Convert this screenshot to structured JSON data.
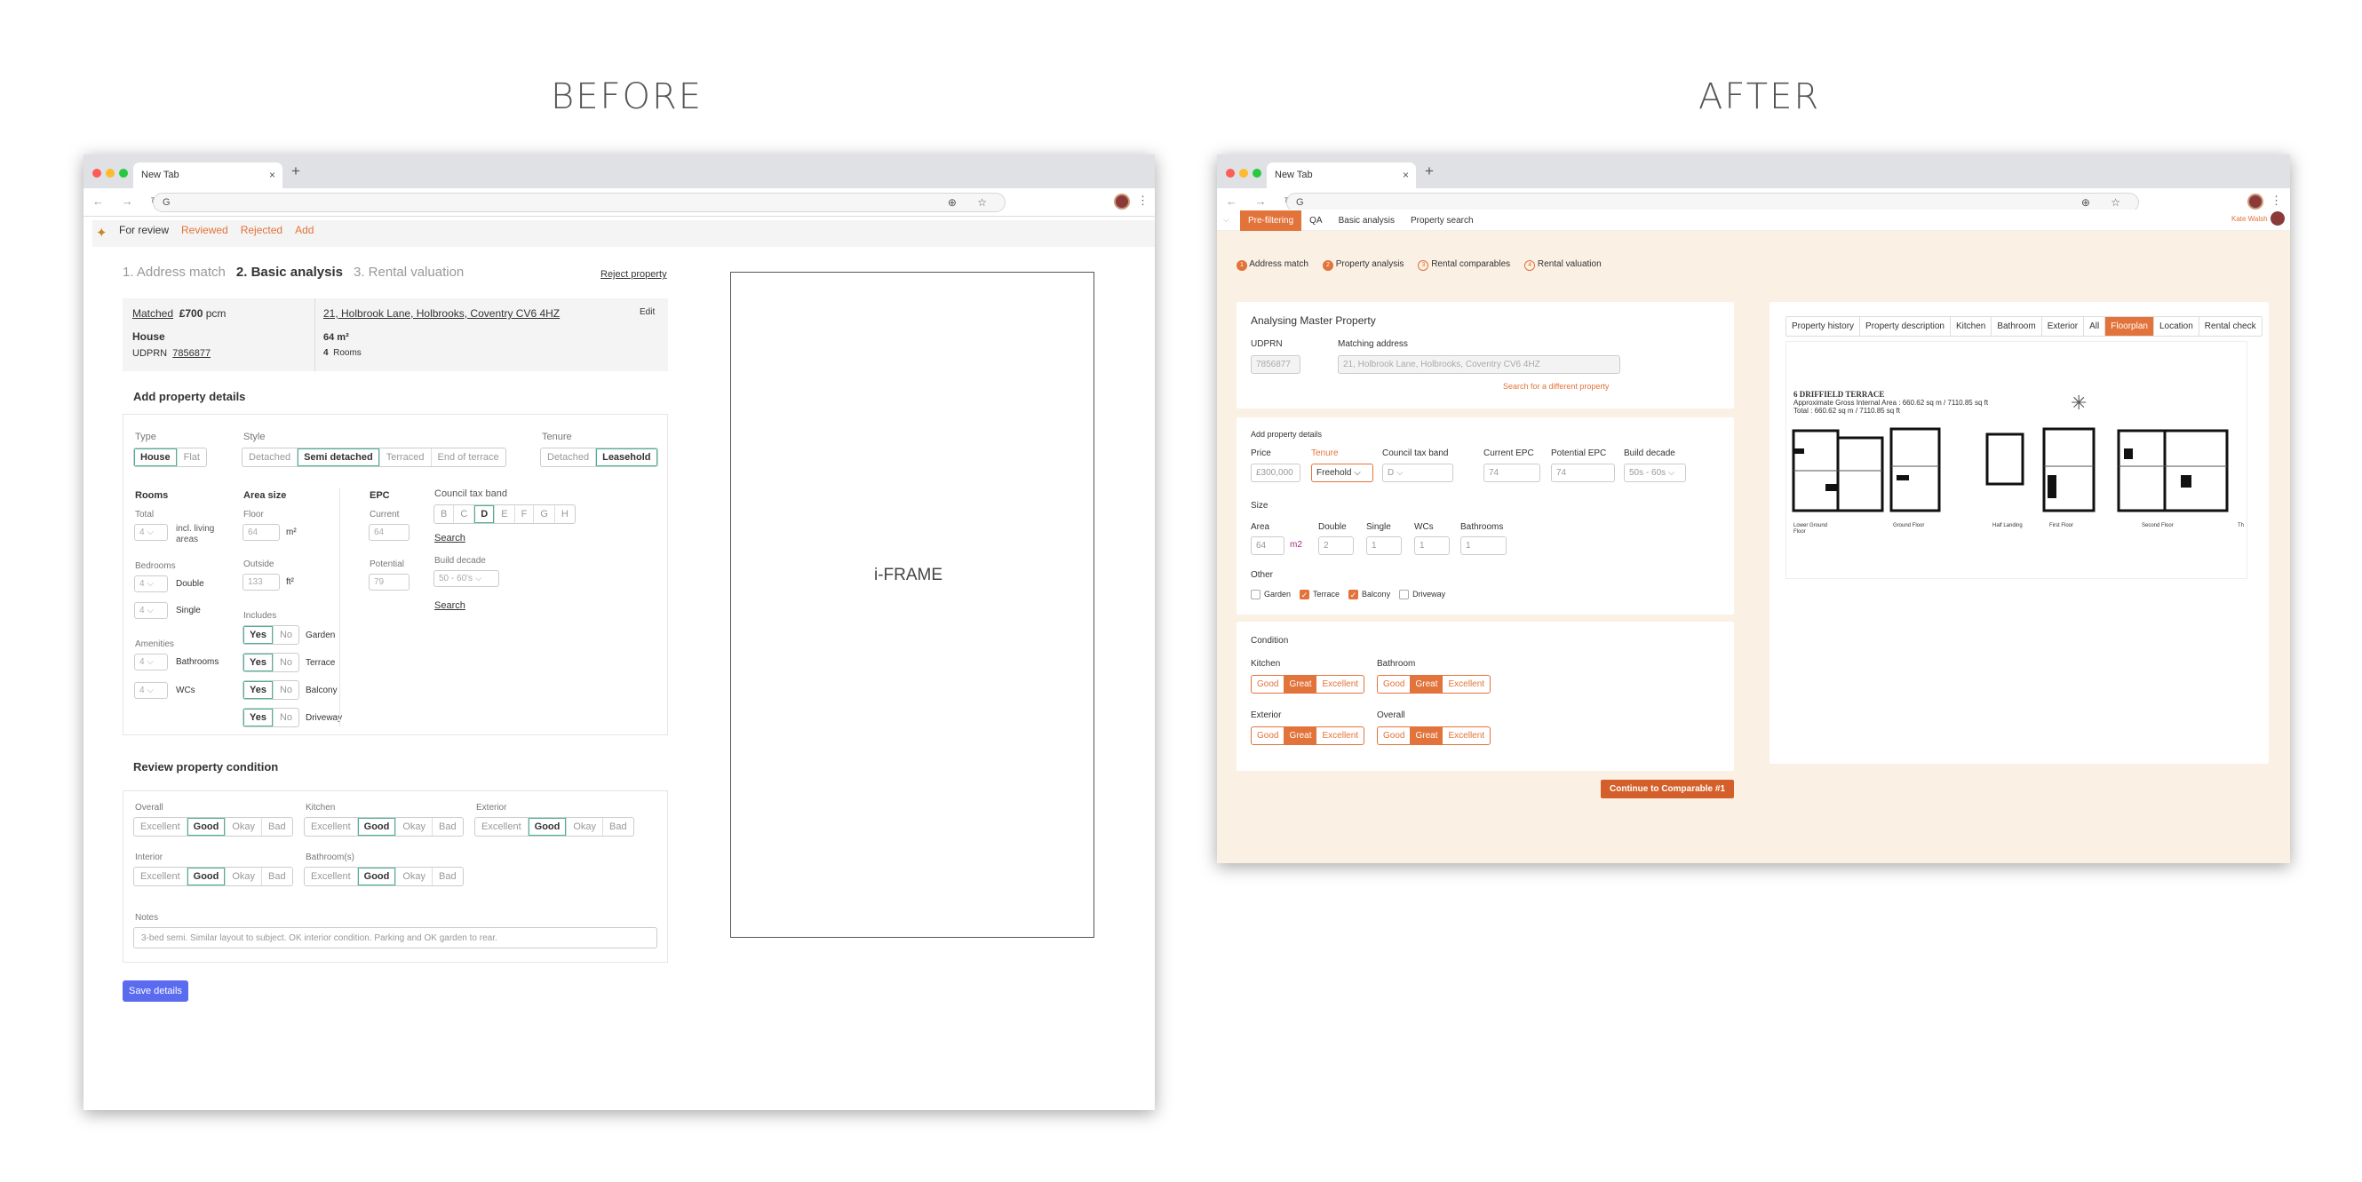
{
  "titles": {
    "before": "BEFORE",
    "after": "AFTER"
  },
  "browser": {
    "tab": "New Tab",
    "close": "×",
    "plus": "+",
    "url": "G",
    "addr_icons": "⊕ ☆",
    "menu": "⋮",
    "nav": "← → ↻"
  },
  "before": {
    "nav": [
      "For review",
      "Reviewed",
      "Rejected",
      "Add"
    ],
    "steps": [
      "1. Address match",
      "2. Basic analysis",
      "3. Rental valuation"
    ],
    "reject": "Reject property",
    "summary": {
      "matched": "Matched",
      "price": "£700",
      "pcm": "pcm",
      "type": "House",
      "udprn_label": "UDPRN",
      "udprn": "7856877",
      "address": "21, Holbrook Lane, Holbrooks, Coventry CV6 4HZ",
      "edit": "Edit",
      "area": "64 m²",
      "rooms_n": "4",
      "rooms": "Rooms"
    },
    "add_title": "Add property details",
    "type_label": "Type",
    "type": [
      "House",
      "Flat"
    ],
    "style_label": "Style",
    "style": [
      "Detached",
      "Semi detached",
      "Terraced",
      "End of terrace"
    ],
    "tenure_label": "Tenure",
    "tenure": [
      "Detached",
      "Leasehold"
    ],
    "rooms_label": "Rooms",
    "total_label": "Total",
    "total": "4",
    "total_note1": "incl. living",
    "total_note2": "areas",
    "bedrooms_label": "Bedrooms",
    "double": "Double",
    "single": "Single",
    "bed_d": "4",
    "bed_s": "4",
    "amenities_label": "Amenities",
    "bathrooms": "Bathrooms",
    "wcs": "WCs",
    "am_b": "4",
    "am_w": "4",
    "area_label": "Area size",
    "floor_label": "Floor",
    "floor": "64",
    "floor_unit": "m²",
    "outside_label": "Outside",
    "outside": "133",
    "outside_unit": "ft²",
    "includes_label": "Includes",
    "yes": "Yes",
    "no": "No",
    "includes": [
      "Garden",
      "Terrace",
      "Balcony",
      "Driveway"
    ],
    "epc_label": "EPC",
    "current_label": "Current",
    "current": "64",
    "potential_label": "Potential",
    "potential": "79",
    "ctax_label": "Council tax band",
    "ctax": [
      "B",
      "C",
      "D",
      "E",
      "F",
      "G",
      "H"
    ],
    "search": "Search",
    "decade_label": "Build decade",
    "decade": "50 - 60's",
    "review_title": "Review property condition",
    "cond_opts": [
      "Excellent",
      "Good",
      "Okay",
      "Bad"
    ],
    "overall": "Overall",
    "kitchen": "Kitchen",
    "exterior": "Exterior",
    "interior": "Interior",
    "bathroom": "Bathroom(s)",
    "notes_label": "Notes",
    "notes": "3-bed semi. Similar layout to subject. OK interior condition. Parking and OK garden to rear.",
    "save": "Save details",
    "iframe": "i-FRAME"
  },
  "after": {
    "nav": [
      "Pre-filtering",
      "QA",
      "Basic analysis",
      "Property search"
    ],
    "user": "Kate Walsh",
    "steps": [
      {
        "n": "1",
        "label": "Address match"
      },
      {
        "n": "2",
        "label": "Property analysis"
      },
      {
        "n": "3",
        "label": "Rental comparables"
      },
      {
        "n": "4",
        "label": "Rental valuation"
      }
    ],
    "analysing": "Analysing Master Property",
    "udprn_label": "UDPRN",
    "udprn": "7856877",
    "match_label": "Matching address",
    "match": "21, Holbrook Lane, Holbrooks, Coventry CV6 4HZ",
    "diff": "Search for a different property",
    "add_title": "Add property details",
    "price_label": "Price",
    "price": "£300,000",
    "tenure_label": "Tenure",
    "tenure": "Freehold",
    "ctax_label": "Council tax band",
    "ctax": "D",
    "cur_epc_label": "Current EPC",
    "cur_epc": "74",
    "pot_epc_label": "Potential EPC",
    "pot_epc": "74",
    "decade_label": "Build decade",
    "decade": "50s - 60s",
    "size_label": "Size",
    "area_label": "Area",
    "area": "64",
    "area_unit": "m2",
    "double_label": "Double",
    "double": "2",
    "single_label": "Single",
    "single": "1",
    "wcs_label": "WCs",
    "wcs": "1",
    "bath_label": "Bathrooms",
    "bath": "1",
    "other_label": "Other",
    "other": [
      {
        "label": "Garden",
        "on": false
      },
      {
        "label": "Terrace",
        "on": true
      },
      {
        "label": "Balcony",
        "on": true
      },
      {
        "label": "Driveway",
        "on": false
      }
    ],
    "cond_title": "Condition",
    "cond_opts": [
      "Good",
      "Great",
      "Excellent"
    ],
    "kitchen": "Kitchen",
    "bathroom": "Bathroom",
    "exterior": "Exterior",
    "overall": "Overall",
    "continue": "Continue to Comparable #1",
    "tabs": [
      "Property history",
      "Property description",
      "Kitchen",
      "Bathroom",
      "Exterior",
      "All",
      "Floorplan",
      "Location",
      "Rental check"
    ],
    "fp_title": "6 DRIFFIELD TERRACE",
    "fp_sub1": "Approximate Gross Internal Area : 660.62 sq m / 7110.85 sq ft",
    "fp_sub2": "Total : 660.62 sq m / 7110.85 sq ft",
    "fp_floors": [
      "Lower Ground Floor",
      "Ground Floor",
      "Half Landing",
      "First Floor",
      "Second Floor",
      "Th"
    ]
  },
  "colors": {
    "accent_before": "#4bb29a",
    "accent_after": "#e2733b",
    "save_btn": "#5b6bf0",
    "after_bg": "#faf0e3"
  }
}
